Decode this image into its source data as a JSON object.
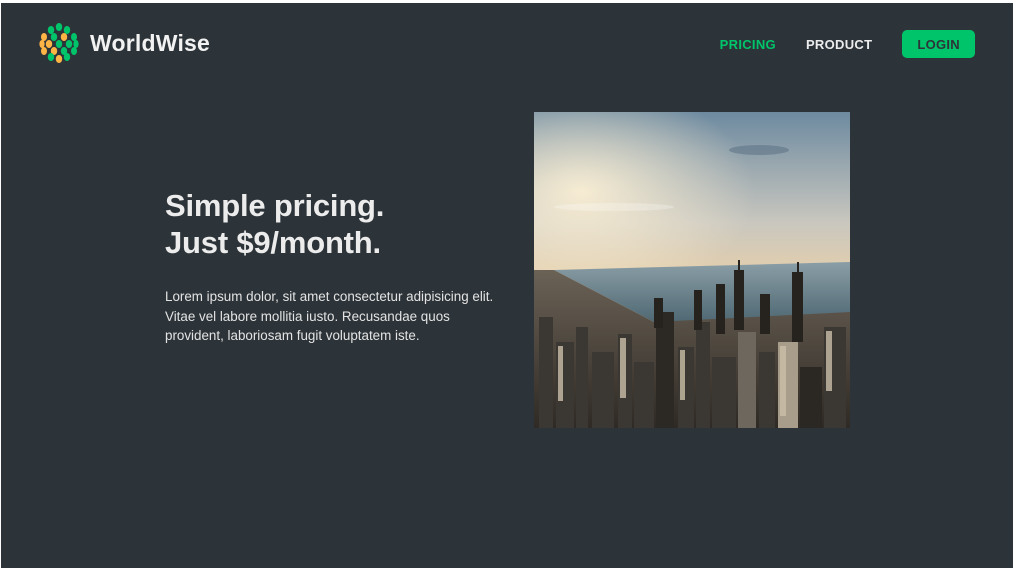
{
  "brand": {
    "name": "WorldWise",
    "logo_icon": "globe-leaf-icon",
    "colors": {
      "green": "#00c46a",
      "yellow": "#ffb545",
      "background": "#2d3439"
    }
  },
  "nav": {
    "items": [
      {
        "label": "PRICING",
        "active": true
      },
      {
        "label": "PRODUCT",
        "active": false
      }
    ],
    "login_label": "LOGIN"
  },
  "content": {
    "headline_line1": "Simple pricing.",
    "headline_line2": "Just $9/month.",
    "body": "Lorem ipsum dolor, sit amet consectetur adipisicing elit. Vitae vel labore mollitia iusto. Recusandae quos provident, laboriosam fugit voluptatem iste."
  },
  "image": {
    "subject": "city-skyline-photo"
  }
}
